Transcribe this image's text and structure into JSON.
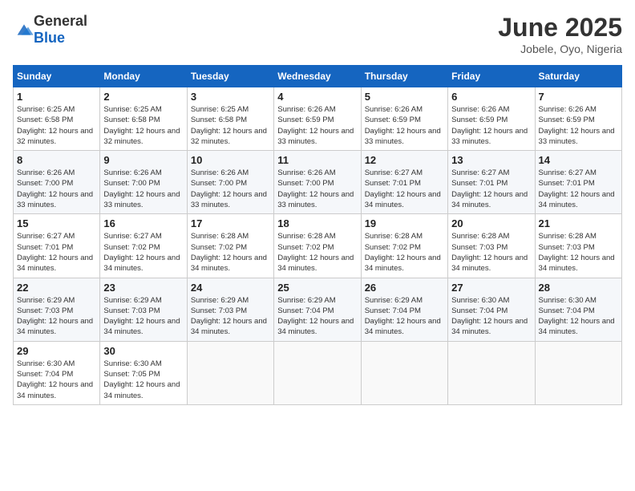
{
  "header": {
    "logo_general": "General",
    "logo_blue": "Blue",
    "month": "June 2025",
    "location": "Jobele, Oyo, Nigeria"
  },
  "days_of_week": [
    "Sunday",
    "Monday",
    "Tuesday",
    "Wednesday",
    "Thursday",
    "Friday",
    "Saturday"
  ],
  "weeks": [
    [
      {
        "day": "1",
        "sunrise": "6:25 AM",
        "sunset": "6:58 PM",
        "daylight": "12 hours and 32 minutes."
      },
      {
        "day": "2",
        "sunrise": "6:25 AM",
        "sunset": "6:58 PM",
        "daylight": "12 hours and 32 minutes."
      },
      {
        "day": "3",
        "sunrise": "6:25 AM",
        "sunset": "6:58 PM",
        "daylight": "12 hours and 32 minutes."
      },
      {
        "day": "4",
        "sunrise": "6:26 AM",
        "sunset": "6:59 PM",
        "daylight": "12 hours and 33 minutes."
      },
      {
        "day": "5",
        "sunrise": "6:26 AM",
        "sunset": "6:59 PM",
        "daylight": "12 hours and 33 minutes."
      },
      {
        "day": "6",
        "sunrise": "6:26 AM",
        "sunset": "6:59 PM",
        "daylight": "12 hours and 33 minutes."
      },
      {
        "day": "7",
        "sunrise": "6:26 AM",
        "sunset": "6:59 PM",
        "daylight": "12 hours and 33 minutes."
      }
    ],
    [
      {
        "day": "8",
        "sunrise": "6:26 AM",
        "sunset": "7:00 PM",
        "daylight": "12 hours and 33 minutes."
      },
      {
        "day": "9",
        "sunrise": "6:26 AM",
        "sunset": "7:00 PM",
        "daylight": "12 hours and 33 minutes."
      },
      {
        "day": "10",
        "sunrise": "6:26 AM",
        "sunset": "7:00 PM",
        "daylight": "12 hours and 33 minutes."
      },
      {
        "day": "11",
        "sunrise": "6:26 AM",
        "sunset": "7:00 PM",
        "daylight": "12 hours and 33 minutes."
      },
      {
        "day": "12",
        "sunrise": "6:27 AM",
        "sunset": "7:01 PM",
        "daylight": "12 hours and 34 minutes."
      },
      {
        "day": "13",
        "sunrise": "6:27 AM",
        "sunset": "7:01 PM",
        "daylight": "12 hours and 34 minutes."
      },
      {
        "day": "14",
        "sunrise": "6:27 AM",
        "sunset": "7:01 PM",
        "daylight": "12 hours and 34 minutes."
      }
    ],
    [
      {
        "day": "15",
        "sunrise": "6:27 AM",
        "sunset": "7:01 PM",
        "daylight": "12 hours and 34 minutes."
      },
      {
        "day": "16",
        "sunrise": "6:27 AM",
        "sunset": "7:02 PM",
        "daylight": "12 hours and 34 minutes."
      },
      {
        "day": "17",
        "sunrise": "6:28 AM",
        "sunset": "7:02 PM",
        "daylight": "12 hours and 34 minutes."
      },
      {
        "day": "18",
        "sunrise": "6:28 AM",
        "sunset": "7:02 PM",
        "daylight": "12 hours and 34 minutes."
      },
      {
        "day": "19",
        "sunrise": "6:28 AM",
        "sunset": "7:02 PM",
        "daylight": "12 hours and 34 minutes."
      },
      {
        "day": "20",
        "sunrise": "6:28 AM",
        "sunset": "7:03 PM",
        "daylight": "12 hours and 34 minutes."
      },
      {
        "day": "21",
        "sunrise": "6:28 AM",
        "sunset": "7:03 PM",
        "daylight": "12 hours and 34 minutes."
      }
    ],
    [
      {
        "day": "22",
        "sunrise": "6:29 AM",
        "sunset": "7:03 PM",
        "daylight": "12 hours and 34 minutes."
      },
      {
        "day": "23",
        "sunrise": "6:29 AM",
        "sunset": "7:03 PM",
        "daylight": "12 hours and 34 minutes."
      },
      {
        "day": "24",
        "sunrise": "6:29 AM",
        "sunset": "7:03 PM",
        "daylight": "12 hours and 34 minutes."
      },
      {
        "day": "25",
        "sunrise": "6:29 AM",
        "sunset": "7:04 PM",
        "daylight": "12 hours and 34 minutes."
      },
      {
        "day": "26",
        "sunrise": "6:29 AM",
        "sunset": "7:04 PM",
        "daylight": "12 hours and 34 minutes."
      },
      {
        "day": "27",
        "sunrise": "6:30 AM",
        "sunset": "7:04 PM",
        "daylight": "12 hours and 34 minutes."
      },
      {
        "day": "28",
        "sunrise": "6:30 AM",
        "sunset": "7:04 PM",
        "daylight": "12 hours and 34 minutes."
      }
    ],
    [
      {
        "day": "29",
        "sunrise": "6:30 AM",
        "sunset": "7:04 PM",
        "daylight": "12 hours and 34 minutes."
      },
      {
        "day": "30",
        "sunrise": "6:30 AM",
        "sunset": "7:05 PM",
        "daylight": "12 hours and 34 minutes."
      },
      null,
      null,
      null,
      null,
      null
    ]
  ]
}
